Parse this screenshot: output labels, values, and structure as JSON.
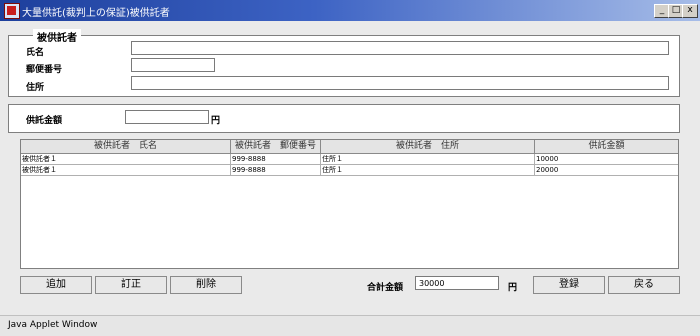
{
  "window": {
    "title": "大量供託(裁判上の保証)被供託者",
    "minimize": "_",
    "maximize": "□",
    "close": "x"
  },
  "depositee": {
    "legend": "被供託者",
    "name_label": "氏名",
    "name_value": "",
    "postal_label": "郵便番号",
    "postal_value": "",
    "address_label": "住所",
    "address_value": ""
  },
  "deposit": {
    "amount_label": "供託金額",
    "amount_value": "",
    "unit": "円"
  },
  "table": {
    "headers": [
      "被供託者　氏名",
      "被供託者　郵便番号",
      "被供託者　住所",
      "供託金額"
    ],
    "rows": [
      [
        "被供託者１",
        "999-8888",
        "住所１",
        "10000"
      ],
      [
        "被供託者１",
        "999-8888",
        "住所１",
        "20000"
      ]
    ]
  },
  "actions": {
    "add": "追加",
    "correct": "訂正",
    "delete": "削除",
    "total_label": "合計金額",
    "total_value": "30000",
    "total_unit": "円",
    "register": "登録",
    "back": "戻る"
  },
  "status": {
    "text": "Java Applet Window"
  }
}
